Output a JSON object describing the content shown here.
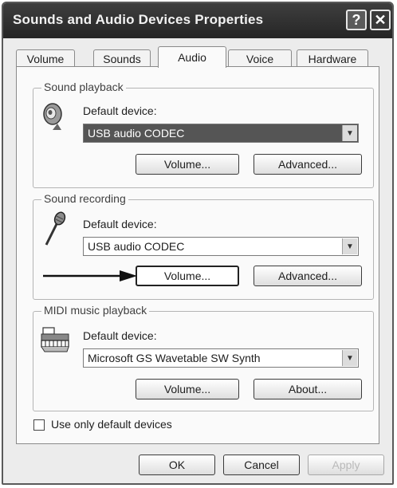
{
  "window": {
    "title": "Sounds and Audio Devices Properties",
    "help_label": "?",
    "close_label": "✕"
  },
  "tabs": [
    {
      "label": "Volume",
      "active": false
    },
    {
      "label": "Sounds",
      "active": false
    },
    {
      "label": "Audio",
      "active": true
    },
    {
      "label": "Voice",
      "active": false
    },
    {
      "label": "Hardware",
      "active": false
    }
  ],
  "sound_playback": {
    "group_label": "Sound playback",
    "device_label": "Default device:",
    "device_value": "USB audio CODEC",
    "volume_button": "Volume...",
    "advanced_button": "Advanced..."
  },
  "sound_recording": {
    "group_label": "Sound recording",
    "device_label": "Default device:",
    "device_value": "USB audio CODEC",
    "volume_button": "Volume...",
    "advanced_button": "Advanced..."
  },
  "midi_playback": {
    "group_label": "MIDI music playback",
    "device_label": "Default device:",
    "device_value": "Microsoft GS Wavetable SW Synth",
    "volume_button": "Volume...",
    "about_button": "About..."
  },
  "use_default_devices": {
    "label": "Use only default devices",
    "checked": false
  },
  "footer": {
    "ok_label": "OK",
    "cancel_label": "Cancel",
    "apply_label": "Apply"
  },
  "icons": {
    "speaker": "speaker-icon",
    "microphone": "microphone-icon",
    "midi": "midi-keyboard-icon",
    "annotation_arrow": "arrow-right-icon"
  }
}
